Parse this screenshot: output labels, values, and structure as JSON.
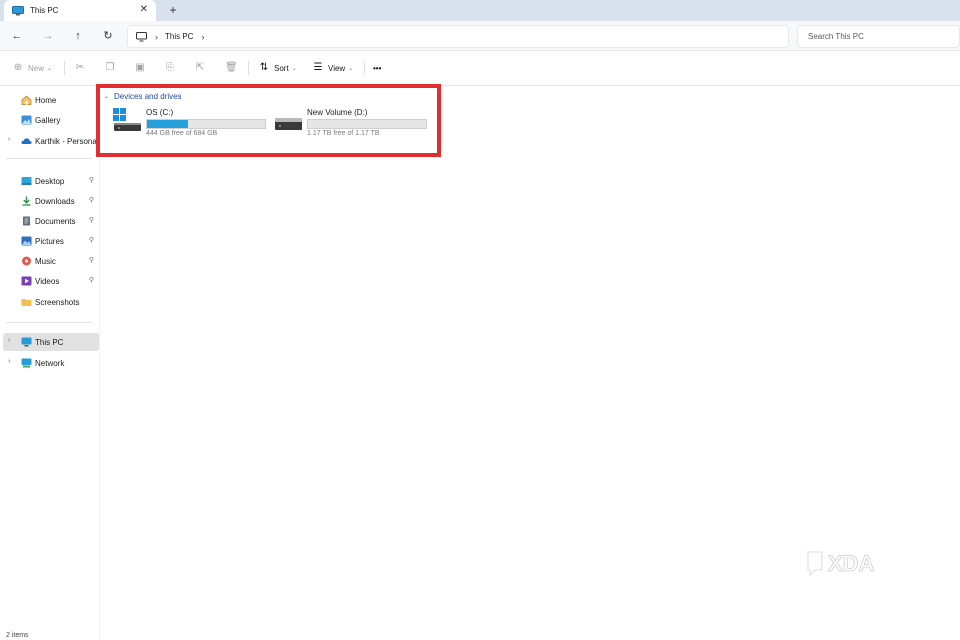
{
  "window": {
    "tab_title": "This PC",
    "tab_close": "✕",
    "new_tab": "+"
  },
  "nav": {
    "back": "←",
    "forward": "→",
    "up": "↑",
    "refresh": "↻",
    "breadcrumb_sep": "›",
    "breadcrumb": "This PC",
    "breadcrumb_trailing": "›"
  },
  "search": {
    "placeholder": "Search This PC"
  },
  "toolbar": {
    "new_label": "New",
    "sort_label": "Sort",
    "view_label": "View",
    "more_label": "•••",
    "chevron": "⌄"
  },
  "sidebar": {
    "items": [
      {
        "label": "Home",
        "icon": "home-icon"
      },
      {
        "label": "Gallery",
        "icon": "gallery-icon"
      },
      {
        "label": "Karthik - Personal",
        "icon": "onedrive-icon"
      },
      {
        "label": "Desktop",
        "icon": "desktop-folder-icon",
        "pinned": true
      },
      {
        "label": "Downloads",
        "icon": "downloads-icon",
        "pinned": true
      },
      {
        "label": "Documents",
        "icon": "documents-icon",
        "pinned": true
      },
      {
        "label": "Pictures",
        "icon": "pictures-icon",
        "pinned": true
      },
      {
        "label": "Music",
        "icon": "music-icon",
        "pinned": true
      },
      {
        "label": "Videos",
        "icon": "videos-icon",
        "pinned": true
      },
      {
        "label": "Screenshots",
        "icon": "folder-icon",
        "pinned": false
      },
      {
        "label": "This PC",
        "icon": "this-pc-icon",
        "selected": true
      },
      {
        "label": "Network",
        "icon": "network-icon"
      }
    ],
    "expand_glyph": "›",
    "pin_glyph": "📌"
  },
  "content": {
    "group_label": "Devices and drives",
    "group_chevron": "⌄",
    "drives": [
      {
        "name": "OS (C:)",
        "free_text": "444 GB free of 684 GB",
        "used_fraction": 0.35,
        "icon": "windows-drive-icon"
      },
      {
        "name": "New Volume (D:)",
        "free_text": "1.17 TB free of 1.17 TB",
        "used_fraction": 0.0,
        "icon": "hard-drive-icon"
      }
    ]
  },
  "status": {
    "item_count": "2 items"
  },
  "watermark": {
    "text": "XDA",
    "logo": "xda-logo"
  },
  "colors": {
    "accent": "#26a0da",
    "highlight": "#e22e2e",
    "link": "#1f4aa5",
    "selection": "#e1e1e1"
  }
}
